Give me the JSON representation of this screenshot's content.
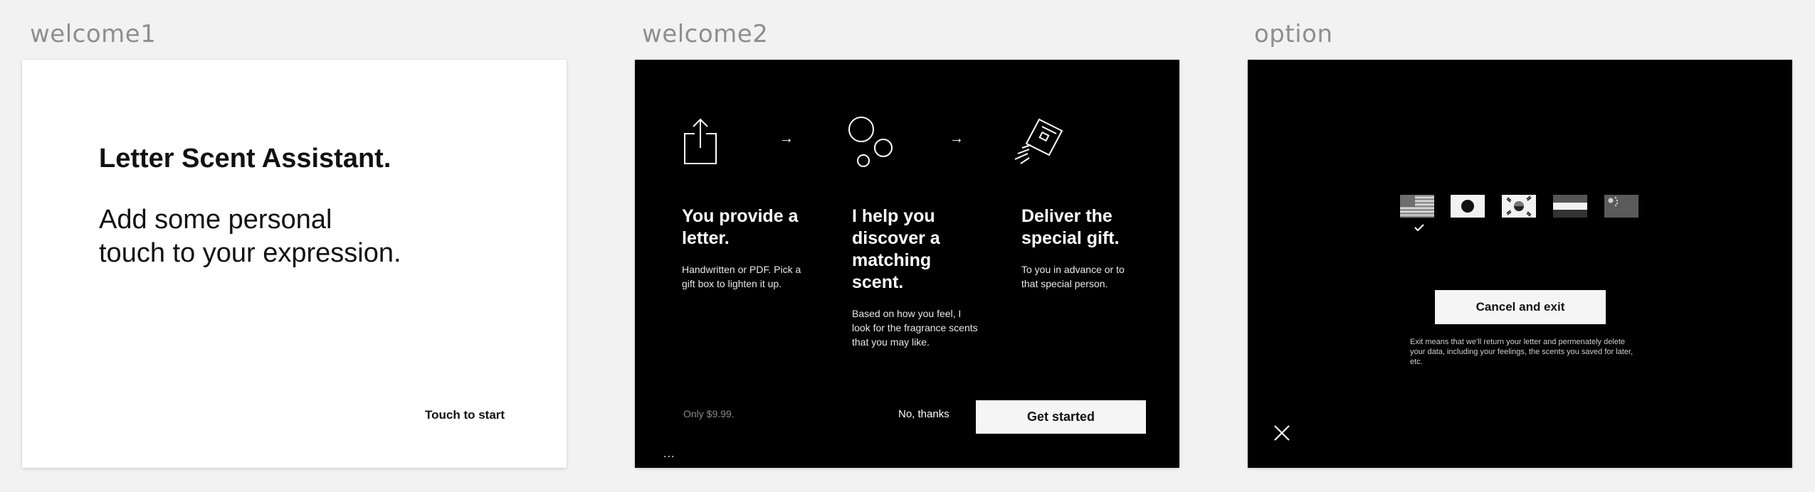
{
  "boards": [
    {
      "label": "welcome1"
    },
    {
      "label": "welcome2"
    },
    {
      "label": "option"
    }
  ],
  "welcome1": {
    "title": "Letter Scent Assistant.",
    "subtitle_line1": "Add some personal",
    "subtitle_line2": "touch to your expression.",
    "start_label": "Touch to start"
  },
  "welcome2": {
    "steps": [
      {
        "icon": "share-upload-icon",
        "heading": "You provide a letter.",
        "body": "Handwritten or PDF. Pick a gift box to lighten it up."
      },
      {
        "icon": "bubbles-icon",
        "heading": "I help you discover a matching scent.",
        "body": "Based on how you feel, I look for the fragrance scents that you may like."
      },
      {
        "icon": "delivery-card-icon",
        "heading": "Deliver the special gift.",
        "body": "To you in advance or to that special person."
      }
    ],
    "arrow": "→",
    "price": "Only $9.99.",
    "no_thanks": "No, thanks",
    "get_started": "Get started",
    "dots": "..."
  },
  "option": {
    "flags": [
      "us-flag-icon",
      "japan-flag-icon",
      "korea-flag-icon",
      "striped-flag-icon",
      "china-flag-icon"
    ],
    "selected_flag": "us-flag-icon",
    "cancel_label": "Cancel and exit",
    "note": "Exit means that we’ll return your letter and permenately delete your data, including your feelings, the scents you saved for later, etc."
  },
  "colors": {
    "canvas": "#f2f2f2",
    "dark": "#000000",
    "light_button": "#f5f5f5",
    "label_gray": "#8e8e8e"
  }
}
